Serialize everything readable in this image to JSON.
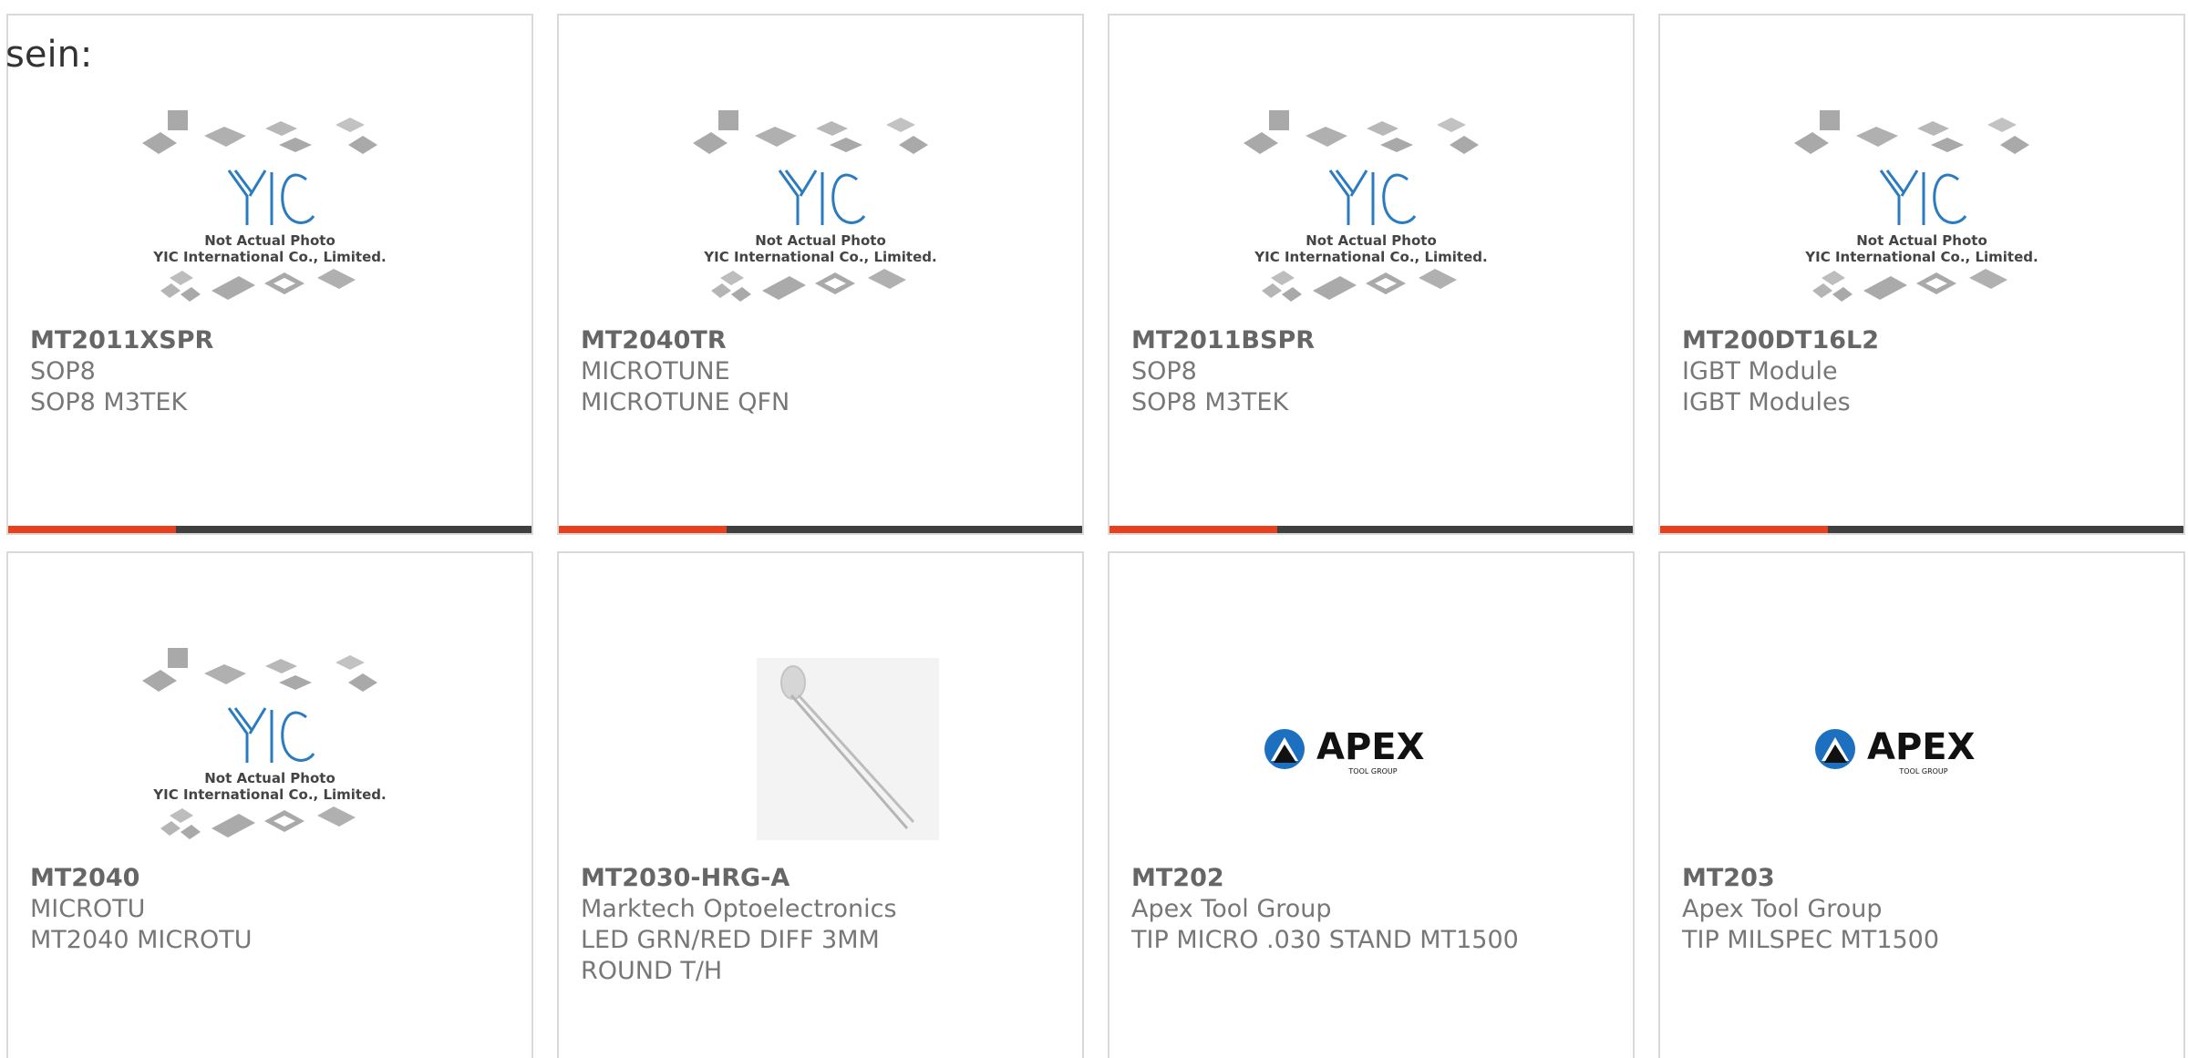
{
  "lead_text": "sein:",
  "placeholder_caption": {
    "line1": "Not Actual Photo",
    "line2": "YIC International Co., Limited.",
    "logo": "YIC"
  },
  "apex_logo": {
    "name": "APEX",
    "sub": "TOOL GROUP"
  },
  "accent_color": "#e8401c",
  "bar_color": "#3f3f3f",
  "products": [
    {
      "part": "MT2011XSPR",
      "line1": "SOP8",
      "line2": "SOP8 M3TEK",
      "image": "yic-placeholder",
      "progress": 0.32
    },
    {
      "part": "MT2040TR",
      "line1": "MICROTUNE",
      "line2": "MICROTUNE QFN",
      "image": "yic-placeholder",
      "progress": 0.32
    },
    {
      "part": "MT2011BSPR",
      "line1": "SOP8",
      "line2": "SOP8 M3TEK",
      "image": "yic-placeholder",
      "progress": 0.32
    },
    {
      "part": "MT200DT16L2",
      "line1": "IGBT Module",
      "line2": "IGBT Modules",
      "image": "yic-placeholder",
      "progress": 0.32
    },
    {
      "part": "MT2040",
      "line1": "MICROTU",
      "line2": "MT2040 MICROTU",
      "image": "yic-placeholder"
    },
    {
      "part": "MT2030-HRG-A",
      "line1": "Marktech Optoelectronics",
      "line2": "LED GRN/RED DIFF 3MM ROUND T/H",
      "image": "led-photo"
    },
    {
      "part": "MT202",
      "line1": "Apex Tool Group",
      "line2": "TIP MICRO .030 STAND MT1500",
      "image": "apex-logo"
    },
    {
      "part": "MT203",
      "line1": "Apex Tool Group",
      "line2": "TIP MILSPEC MT1500",
      "image": "apex-logo"
    }
  ]
}
